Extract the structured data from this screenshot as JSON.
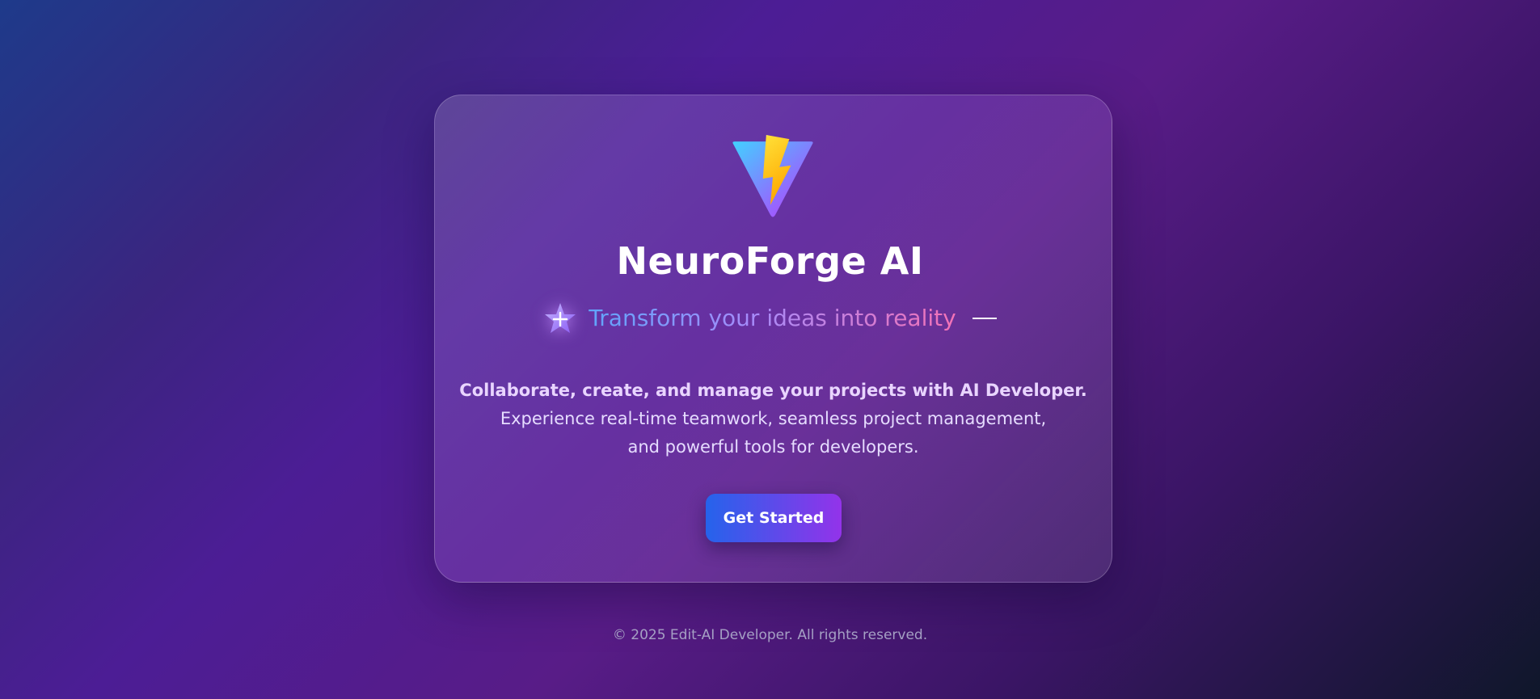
{
  "hero": {
    "title": "NeuroForge AI",
    "tagline": "Transform your ideas into reality",
    "description_bold": "Collaborate, create, and manage your projects with AI Developer.",
    "description_rest": "Experience real-time teamwork, seamless project management, and powerful tools for developers.",
    "cta_label": "Get Started"
  },
  "icons": {
    "logo": "lightning-triangle-logo",
    "tagline_icon": "sparkle-star-icon"
  },
  "footer": {
    "copyright": "© 2025 Edit-AI Developer. All rights reserved."
  },
  "colors": {
    "accent_blue": "#2563eb",
    "accent_purple": "#9333ea",
    "tagline_start": "#60a5fa",
    "tagline_end": "#f472b6"
  }
}
